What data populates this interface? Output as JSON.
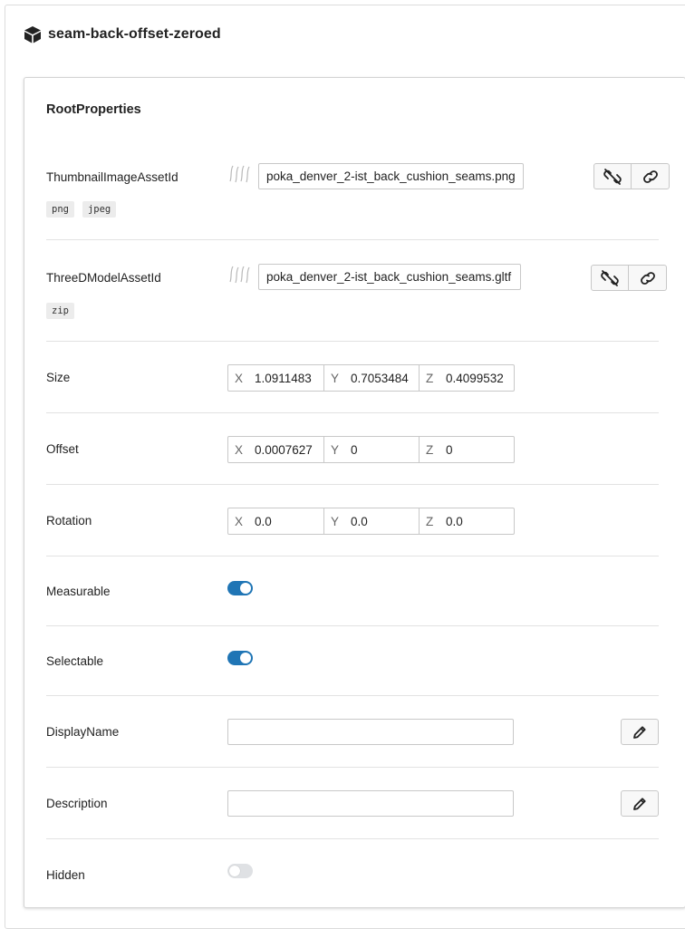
{
  "header": {
    "title": "seam-back-offset-zeroed",
    "icon": "cube-icon"
  },
  "panel": {
    "title": "RootProperties"
  },
  "thumbnail": {
    "label": "ThumbnailImageAssetId",
    "value": "poka_denver_2-ist_back_cushion_seams.png",
    "tags": [
      "png",
      "jpeg"
    ]
  },
  "model": {
    "label": "ThreeDModelAssetId",
    "value": "poka_denver_2-ist_back_cushion_seams.gltf",
    "tags": [
      "zip"
    ]
  },
  "size": {
    "label": "Size",
    "x_axis": "X",
    "y_axis": "Y",
    "z_axis": "Z",
    "x": "1.0911483",
    "y": "0.7053484",
    "z": "0.4099532"
  },
  "offset": {
    "label": "Offset",
    "x_axis": "X",
    "y_axis": "Y",
    "z_axis": "Z",
    "x": "0.0007627",
    "y": "0",
    "z": "0"
  },
  "rotation": {
    "label": "Rotation",
    "x_axis": "X",
    "y_axis": "Y",
    "z_axis": "Z",
    "x": "0.0",
    "y": "0.0",
    "z": "0.0"
  },
  "measurable": {
    "label": "Measurable",
    "on": true
  },
  "selectable": {
    "label": "Selectable",
    "on": true
  },
  "display_name": {
    "label": "DisplayName",
    "value": ""
  },
  "description": {
    "label": "Description",
    "value": ""
  },
  "hidden": {
    "label": "Hidden",
    "on": false
  },
  "colors": {
    "toggle_on": "#1f75b5",
    "toggle_off": "#dfe1e4"
  }
}
